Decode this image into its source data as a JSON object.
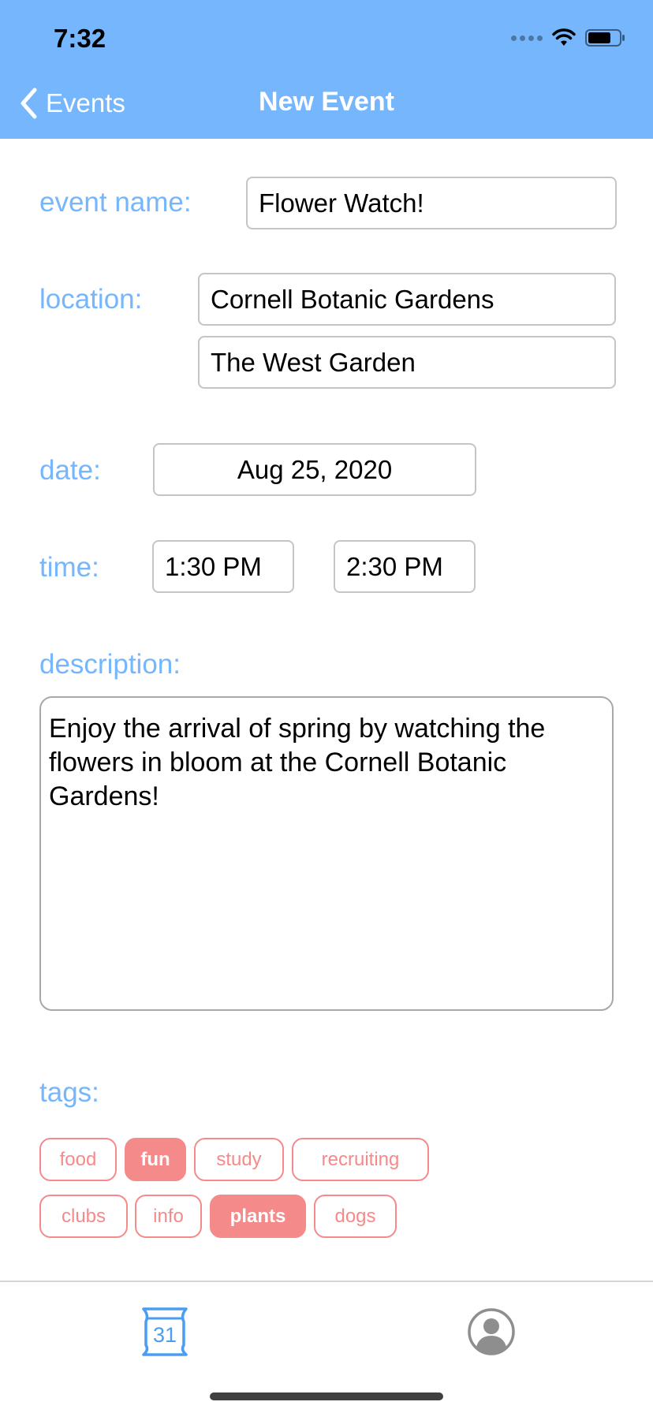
{
  "status_bar": {
    "time": "7:32"
  },
  "nav": {
    "back_label": "Events",
    "title": "New Event"
  },
  "form": {
    "event_name_label": "event name:",
    "event_name_value": "Flower Watch!",
    "location_label": "location:",
    "location_line1": "Cornell Botanic Gardens",
    "location_line2": "The West Garden",
    "date_label": "date:",
    "date_value": "Aug 25, 2020",
    "time_label": "time:",
    "start_time": "1:30 PM",
    "end_time": "2:30 PM",
    "description_label": "description:",
    "description_value": "Enjoy the arrival of spring by watching the flowers in bloom at the Cornell Botanic Gardens!",
    "tags_label": "tags:"
  },
  "tags": [
    {
      "label": "food",
      "selected": false
    },
    {
      "label": "fun",
      "selected": true
    },
    {
      "label": "study",
      "selected": false
    },
    {
      "label": "recruiting",
      "selected": false
    },
    {
      "label": "clubs",
      "selected": false
    },
    {
      "label": "info",
      "selected": false
    },
    {
      "label": "plants",
      "selected": true
    },
    {
      "label": "dogs",
      "selected": false
    }
  ],
  "tab_bar": {
    "calendar_day": "31"
  },
  "colors": {
    "accent_blue": "#75b6fc",
    "tag_red": "#f58a8a",
    "field_border": "#c5c5c5"
  },
  "icons": {
    "back": "chevron-left-icon",
    "calendar": "calendar-icon",
    "profile": "profile-icon",
    "wifi": "wifi-icon",
    "battery": "battery-icon"
  }
}
